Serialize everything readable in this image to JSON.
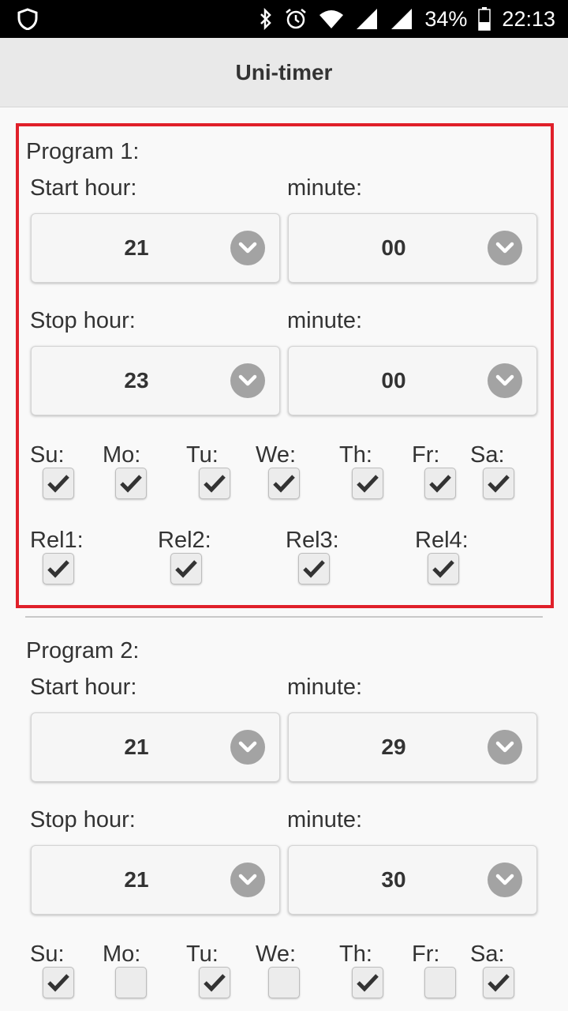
{
  "status_bar": {
    "battery": "34%",
    "time": "22:13"
  },
  "app": {
    "title": "Uni-timer"
  },
  "labels": {
    "start_hour": "Start hour:",
    "stop_hour": "Stop hour:",
    "minute": "minute:",
    "days": [
      "Su:",
      "Mo:",
      "Tu:",
      "We:",
      "Th:",
      "Fr:",
      "Sa:"
    ],
    "relays": [
      "Rel1:",
      "Rel2:",
      "Rel3:",
      "Rel4:"
    ]
  },
  "programs": [
    {
      "title": "Program 1:",
      "start_hour": "21",
      "start_minute": "00",
      "stop_hour": "23",
      "stop_minute": "00",
      "days": [
        true,
        true,
        true,
        true,
        true,
        true,
        true
      ],
      "relays": [
        true,
        true,
        true,
        true
      ]
    },
    {
      "title": "Program 2:",
      "start_hour": "21",
      "start_minute": "29",
      "stop_hour": "21",
      "stop_minute": "30",
      "days": [
        true,
        false,
        true,
        false,
        true,
        false,
        true
      ]
    }
  ],
  "colors": {
    "selection_border": "#e0202a",
    "arrow_circle": "#a3a3a3",
    "appbar": "#e9e9e9"
  },
  "icons": [
    "shield-icon",
    "bluetooth-icon",
    "alarm-icon",
    "wifi-icon",
    "signal-icon",
    "battery-icon",
    "chevron-down-icon",
    "checkmark-icon"
  ]
}
